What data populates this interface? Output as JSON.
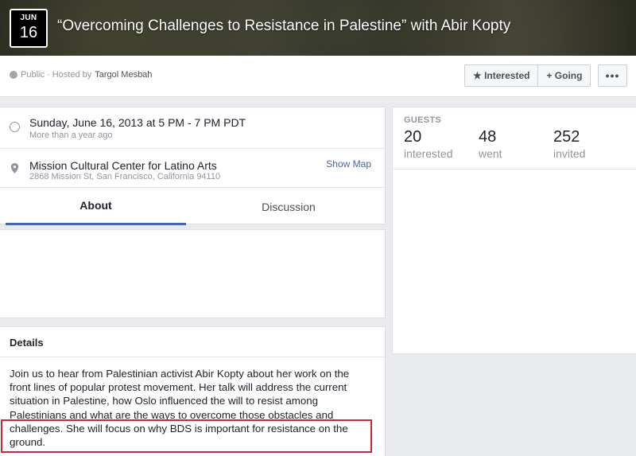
{
  "event": {
    "month": "JUN",
    "day": "16",
    "title": "“Overcoming Challenges to Resistance in Palestine” with Abir Kopty"
  },
  "actionbar": {
    "privacy": "Public · Hosted by",
    "host": "Targol Mesbah",
    "interested_label": "★ Interested",
    "going_label": "+ Going",
    "more_label": "•••"
  },
  "info": {
    "datetime": "Sunday, June 16, 2013 at 5 PM - 7 PM PDT",
    "relative": "More than a year ago",
    "venue": "Mission Cultural Center for Latino Arts",
    "address": "2868 Mission St, San Francisco, California 94110",
    "show_map": "Show Map"
  },
  "tabs": {
    "about": "About",
    "discussion": "Discussion"
  },
  "details": {
    "heading": "Details",
    "lines": [
      "Join us to hear from Palestinian activist Abir Kopty about her work on the",
      "front lines of popular protest movement. Her talk will address the current",
      "situation in Palestine, how Oslo influenced the will to resist among",
      "Palestinians and what are the ways to overcome those obstacles and",
      "challenges. She will focus on why BDS is important for resistance on the",
      "ground."
    ]
  },
  "guests": {
    "label": "GUESTS",
    "stats": [
      {
        "count": "20",
        "label": "interested"
      },
      {
        "count": "48",
        "label": "went"
      },
      {
        "count": "252",
        "label": "invited"
      }
    ]
  },
  "colors": {
    "accent": "#4267b2",
    "highlight": "#c42b35",
    "link": "#4b67a1"
  },
  "icons": [
    "calendar-date-icon",
    "globe-icon",
    "clock-icon",
    "map-pin-icon"
  ]
}
